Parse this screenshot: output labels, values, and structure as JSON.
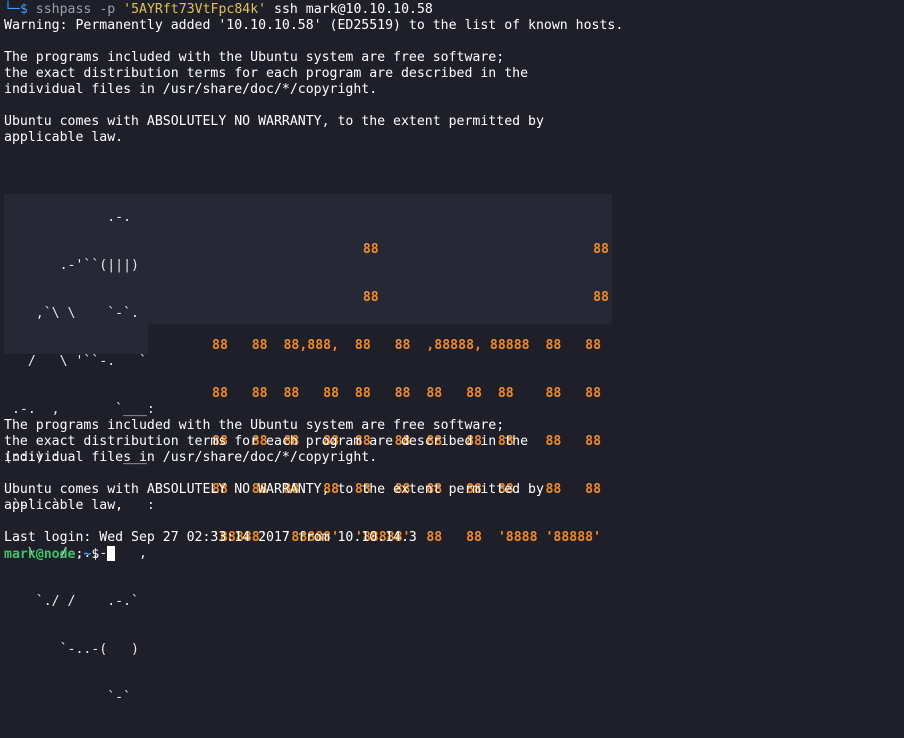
{
  "prompt": {
    "tree_prefix": "└─",
    "dollar": "$",
    "cmd": "sshpass",
    "flag": "-p",
    "password": "'5AYRft73VtFpc84k'",
    "rest": "ssh mark@10.10.10.58"
  },
  "warning": "Warning: Permanently added '10.10.10.58' (ED25519) to the list of known hosts.",
  "motd1": [
    "The programs included with the Ubuntu system are free software;",
    "the exact distribution terms for each program are described in the",
    "individual files in /usr/share/doc/*/copyright."
  ],
  "warranty1": [
    "Ubuntu comes with ABSOLUTELY NO WARRANTY, to the extent permitted by",
    "applicable law."
  ],
  "ascii_logo": [
    "             .-.",
    "       .-'``(|||)",
    "    ,`\\ \\    `-`.",
    "   /   \\ '``-.   `",
    " .-.  ,       `___:",
    "(:::) :        ___",
    " `-`  `       ,   :",
    "   \\   / ,..-`   ,",
    "    `./ /    .-.`",
    "       `-..-(   )",
    "             `-`"
  ],
  "ascii_node": [
    "                   88                           88",
    "                   88                           88",
    "88   88  88,888,  88   88  ,88888, 88888  88   88",
    "88   88  88   88  88   88  88   88  88    88   88",
    "88   88  88   88  88   88  88   88  88    88   88",
    "88   88  88   88  88   88  88   88  88    88   88",
    "'88888'  '88888'  '88888'  88   88  '8888 '88888'"
  ],
  "motd2": [
    "The programs included with the Ubuntu system are free software;",
    "the exact distribution terms for each program are described in the",
    "individual files in /usr/share/doc/*/copyright."
  ],
  "warranty2": [
    "Ubuntu comes with ABSOLUTELY NO WARRANTY, to the extent permitted by",
    "applicable law."
  ],
  "last_login": "Last login: Wed Sep 27 02:33:14 2017 from 10.10.14.3",
  "shell_prompt": {
    "user_host": "mark@node",
    "sep": ":",
    "cwd": "~",
    "dollar": "$ "
  }
}
